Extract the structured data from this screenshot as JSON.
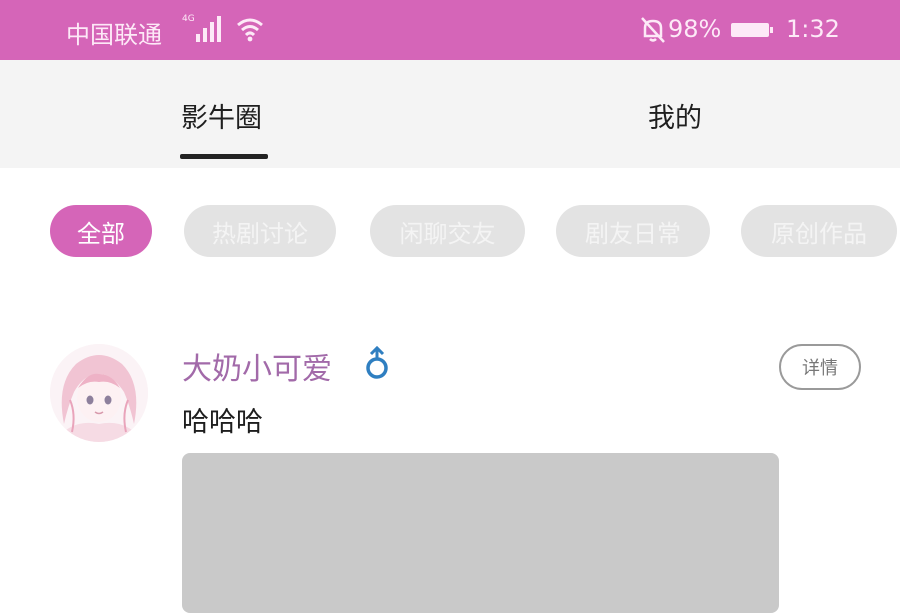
{
  "status_bar": {
    "carrier": "中国联通",
    "network": "4G",
    "battery": "98%",
    "time": "1:32",
    "icons": [
      "signal-icon",
      "wifi-icon",
      "mute-icon",
      "battery-icon"
    ]
  },
  "tabs": [
    {
      "label": "影牛圈",
      "active": true
    },
    {
      "label": "我的",
      "active": false
    }
  ],
  "categories": [
    {
      "label": "全部",
      "active": true
    },
    {
      "label": "热剧讨论",
      "active": false
    },
    {
      "label": "闲聊交友",
      "active": false
    },
    {
      "label": "剧友日常",
      "active": false
    },
    {
      "label": "原创作品",
      "active": false
    }
  ],
  "post": {
    "username": "大奶小可爱",
    "gender_icon": "male-icon",
    "detail_label": "详情",
    "text": "哈哈哈"
  },
  "colors": {
    "accent": "#d565b8",
    "username": "#a26aa9",
    "gender": "#2f7fc1",
    "chip_inactive": "#e3e3e3"
  }
}
